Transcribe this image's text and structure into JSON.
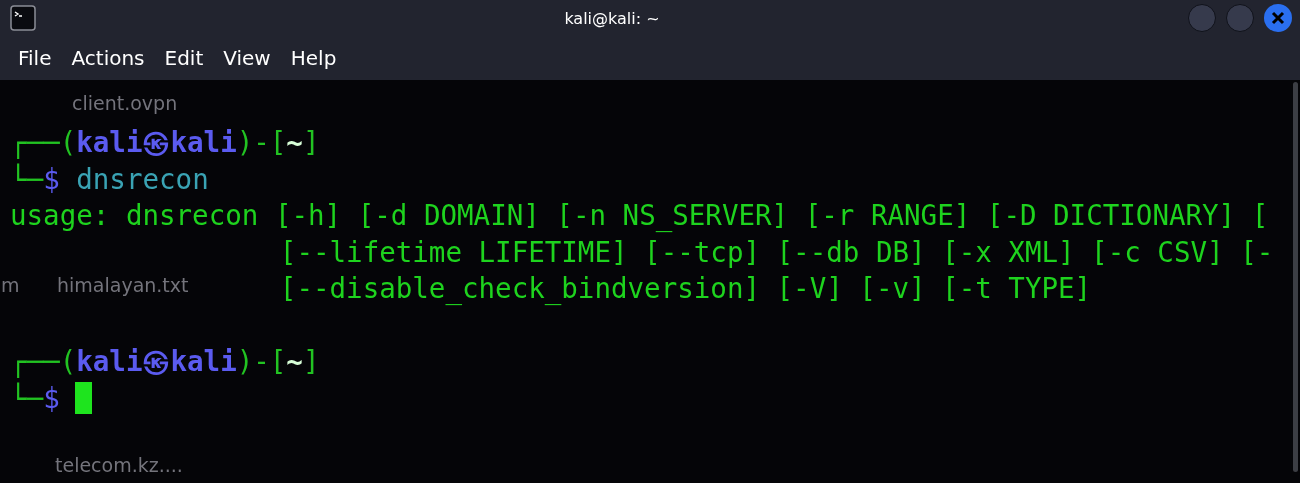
{
  "window": {
    "title": "kali@kali: ~"
  },
  "menu": [
    {
      "label": "File"
    },
    {
      "label": "Actions"
    },
    {
      "label": "Edit"
    },
    {
      "label": "View"
    },
    {
      "label": "Help"
    }
  ],
  "desktop": {
    "icons": [
      {
        "label": "client.ovpn",
        "kind": "label"
      },
      {
        "label": "m",
        "kind": "label"
      },
      {
        "label": "himalayan.txt",
        "kind": "label"
      },
      {
        "label": "telecom.kz....",
        "kind": "label"
      }
    ]
  },
  "terminal": {
    "lines": [
      {
        "kind": "prompt",
        "segments": [
          {
            "text": "┌──(",
            "kind": "frame"
          },
          {
            "text": "kali㉿kali",
            "kind": "user"
          },
          {
            "text": ")-[",
            "kind": "frame"
          },
          {
            "text": "~",
            "kind": "cwd"
          },
          {
            "text": "]",
            "kind": "frame"
          }
        ]
      },
      {
        "kind": "command",
        "cursor": false,
        "segments": [
          {
            "text": "└─",
            "kind": "frame"
          },
          {
            "text": "$",
            "kind": "symbol"
          },
          {
            "text": "dnsrecon",
            "kind": "command"
          }
        ]
      },
      {
        "kind": "output",
        "segments": [
          {
            "text": "usage: dnsrecon [-h] [-d DOMAIN] [-n NS_SERVER] [-r RANGE] [-D DICTIONARY] [",
            "kind": "output"
          }
        ]
      },
      {
        "kind": "continuation",
        "segments": [
          {
            "text": "[--lifetime LIFETIME] [--tcp] [--db DB] [-x XML] [-c CSV] [-",
            "kind": "output"
          }
        ]
      },
      {
        "kind": "continuation",
        "segments": [
          {
            "text": "[--disable_check_bindversion] [-V] [-v] [-t TYPE]",
            "kind": "output"
          }
        ]
      },
      {
        "kind": "blank"
      },
      {
        "kind": "prompt",
        "segments": [
          {
            "text": "┌──(",
            "kind": "frame"
          },
          {
            "text": "kali㉿kali",
            "kind": "user"
          },
          {
            "text": ")-[",
            "kind": "frame"
          },
          {
            "text": "~",
            "kind": "cwd"
          },
          {
            "text": "]",
            "kind": "frame"
          }
        ]
      },
      {
        "kind": "command",
        "cursor": true,
        "segments": [
          {
            "text": "└─",
            "kind": "frame"
          },
          {
            "text": "$",
            "kind": "symbol"
          }
        ]
      }
    ]
  }
}
